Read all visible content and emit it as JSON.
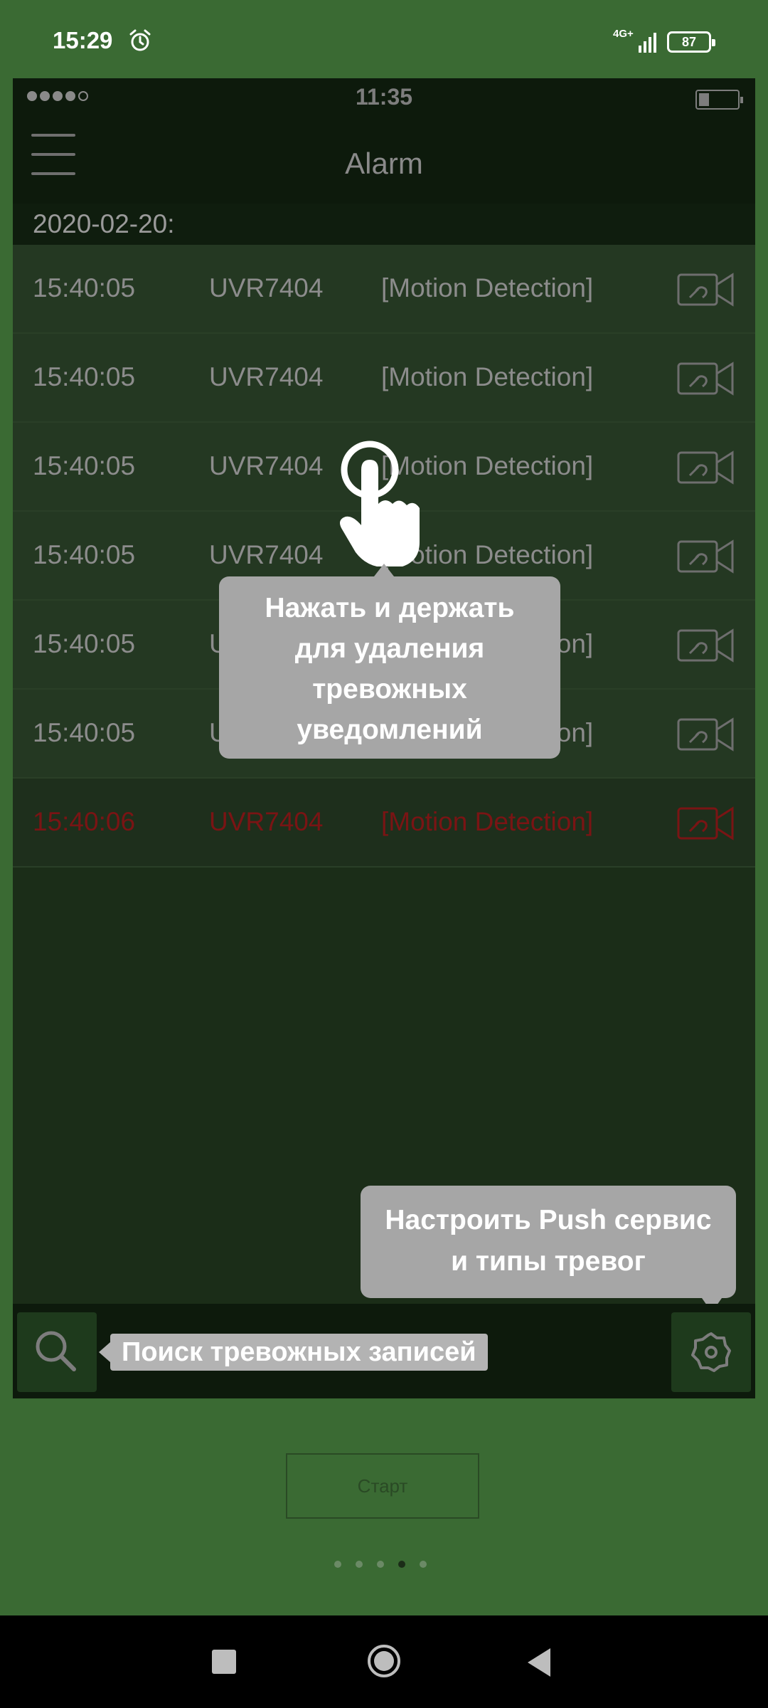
{
  "system_status": {
    "time": "15:29",
    "network": "4G+",
    "battery": "87"
  },
  "mock": {
    "status_time": "11:35",
    "header_title": "Alarm",
    "date": "2020-02-20:",
    "alarms": [
      {
        "time": "15:40:05",
        "device": "UVR7404",
        "type": "[Motion Detection]",
        "unread": false
      },
      {
        "time": "15:40:05",
        "device": "UVR7404",
        "type": "[Motion Detection]",
        "unread": false
      },
      {
        "time": "15:40:05",
        "device": "UVR7404",
        "type": "[Motion Detection]",
        "unread": false
      },
      {
        "time": "15:40:05",
        "device": "UVR7404",
        "type": "[Motion Detection]",
        "unread": false
      },
      {
        "time": "15:40:05",
        "device": "UVR7404",
        "type": "[Motion Detection]",
        "unread": false
      },
      {
        "time": "15:40:05",
        "device": "UVR7404",
        "type": "[Motion Detection]",
        "unread": false
      },
      {
        "time": "15:40:06",
        "device": "UVR7404",
        "type": "[Motion Detection]",
        "unread": true
      }
    ],
    "tip_hold": [
      "Нажать и держать",
      "для удаления",
      "тревожных",
      "уведомлений"
    ],
    "tip_push": [
      "Настроить Push сервис",
      "и типы тревог"
    ],
    "tip_search": "Поиск тревожных записей"
  },
  "start_button": "Старт",
  "pager": {
    "count": 5,
    "active_index": 3
  },
  "colors": {
    "background": "#3a6a33",
    "panel": "#1b2d18",
    "unread_text": "#7a1414",
    "tooltip": "#a6a6a6"
  },
  "icons": [
    "alarm-clock-icon",
    "signal-icon",
    "battery-icon",
    "menu-icon",
    "camera-link-icon",
    "tap-hand-icon",
    "search-icon",
    "settings-gear-icon",
    "nav-recents-icon",
    "nav-home-icon",
    "nav-back-icon"
  ]
}
